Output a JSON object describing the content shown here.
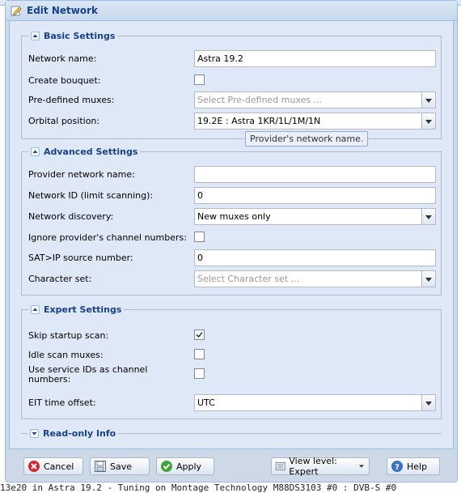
{
  "window": {
    "title": "Edit Network"
  },
  "basic": {
    "legend": "Basic Settings",
    "network_name_label": "Network name:",
    "network_name_value": "Astra 19.2",
    "create_bouquet_label": "Create bouquet:",
    "create_bouquet_checked": false,
    "predefined_muxes_label": "Pre-defined muxes:",
    "predefined_muxes_placeholder": "Select Pre-defined muxes ...",
    "orbital_label": "Orbital position:",
    "orbital_value": "19.2E : Astra 1KR/1L/1M/1N"
  },
  "advanced": {
    "legend": "Advanced Settings",
    "provider_name_label": "Provider network name:",
    "provider_name_value": "",
    "network_id_label": "Network ID (limit scanning):",
    "network_id_value": "0",
    "discovery_label": "Network discovery:",
    "discovery_value": "New muxes only",
    "ignore_numbers_label": "Ignore provider's channel numbers:",
    "ignore_numbers_checked": false,
    "satip_label": "SAT>IP source number:",
    "satip_value": "0",
    "charset_label": "Character set:",
    "charset_placeholder": "Select Character set ..."
  },
  "tooltip": {
    "text": "Provider's network name."
  },
  "expert": {
    "legend": "Expert Settings",
    "skip_scan_label": "Skip startup scan:",
    "skip_scan_checked": true,
    "idle_scan_label": "Idle scan muxes:",
    "idle_scan_checked": false,
    "service_ids_label": "Use service IDs as channel numbers:",
    "service_ids_checked": false,
    "eit_offset_label": "EIT time offset:",
    "eit_offset_value": "UTC"
  },
  "readonly": {
    "legend": "Read-only Info"
  },
  "toolbar": {
    "cancel": "Cancel",
    "save": "Save",
    "apply": "Apply",
    "view_level": "View level: Expert",
    "help": "Help"
  },
  "background": {
    "status_line": "13e20 in Astra 19.2 - Tuning on Montage Technology M88DS3103 #0 : DVB-S #0"
  },
  "colors": {
    "legend_text": "#15428b",
    "panel_bg": "#dfe8f6",
    "cancel_icon": "#d9262c",
    "apply_icon": "#3fa535"
  }
}
